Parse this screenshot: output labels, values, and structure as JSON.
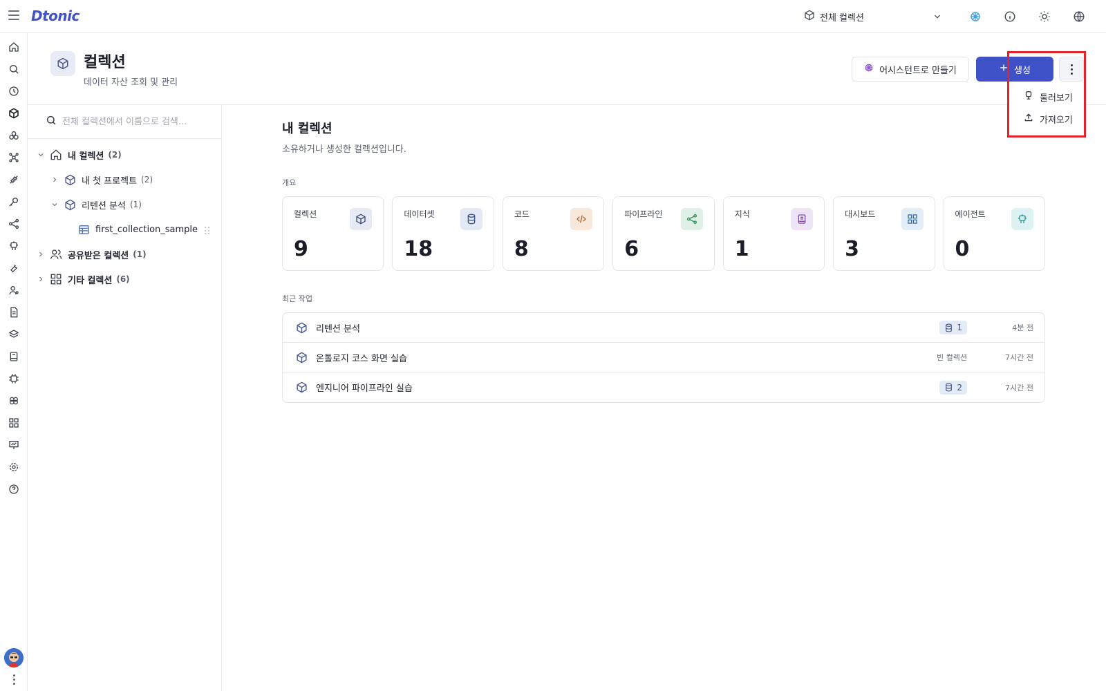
{
  "app": {
    "logo": "Dtonic"
  },
  "topbar": {
    "scope_label": "전체 컬렉션",
    "icons": [
      "cube-icon",
      "chevron-down-icon",
      "assistant-icon",
      "info-icon",
      "theme-sun-icon",
      "globe-icon"
    ]
  },
  "rail": {
    "items": [
      "home-icon",
      "search-icon",
      "history-icon",
      "collection-icon",
      "group-icon",
      "cluster-icon",
      "connector-icon",
      "key-icon",
      "share-icon",
      "agent-icon",
      "tool-icon",
      "user-icon",
      "document-icon",
      "layers-icon",
      "notebook-icon",
      "chip-icon",
      "brain-icon",
      "dashboard-icon",
      "presentation-icon",
      "settings-icon",
      "help-icon"
    ]
  },
  "page": {
    "title": "컬렉션",
    "subtitle": "데이터 자산 조회 및 관리",
    "assistant_button": "어시스턴트로 만들기",
    "create_button": "생성",
    "menu": {
      "items": [
        "둘러보기",
        "가져오기"
      ]
    }
  },
  "tree": {
    "search_placeholder": "전체 컬렉션에서 이름으로 검색...",
    "my_collections": {
      "label": "내 컬렉션",
      "count": "(2)"
    },
    "project1": {
      "label": "내 첫 프로젝트",
      "count": "(2)"
    },
    "project2": {
      "label": "리텐션 분석",
      "count": "(1)"
    },
    "dataset": {
      "label": "first_collection_sample"
    },
    "shared": {
      "label": "공유받은 컬렉션",
      "count": "(1)"
    },
    "other": {
      "label": "기타 컬렉션",
      "count": "(6)"
    }
  },
  "main": {
    "title": "내 컬렉션",
    "subtitle": "소유하거나 생성한 컬렉션입니다.",
    "overview_label": "개요",
    "recent_label": "최근 작업",
    "cards": [
      {
        "label": "컬렉션",
        "value": "9",
        "icon": "cube-icon",
        "bg": "#e6eaf4",
        "fg": "#3d4b7a"
      },
      {
        "label": "데이터셋",
        "value": "18",
        "icon": "database-icon",
        "bg": "#e2e9f5",
        "fg": "#3e5488"
      },
      {
        "label": "코드",
        "value": "8",
        "icon": "code-icon",
        "bg": "#f8e8dc",
        "fg": "#b4622e"
      },
      {
        "label": "파이프라인",
        "value": "6",
        "icon": "pipeline-icon",
        "bg": "#dff1e6",
        "fg": "#2f8a57"
      },
      {
        "label": "지식",
        "value": "1",
        "icon": "book-icon",
        "bg": "#eee4f6",
        "fg": "#7b4ba6"
      },
      {
        "label": "대시보드",
        "value": "3",
        "icon": "dashboard-icon",
        "bg": "#e3eef8",
        "fg": "#3a6fa8"
      },
      {
        "label": "에이전트",
        "value": "0",
        "icon": "agent-icon",
        "bg": "#ddf3f3",
        "fg": "#2a9191"
      }
    ],
    "recent": [
      {
        "name": "리텐션 분석",
        "badge": "1",
        "time": "4분 전"
      },
      {
        "name": "온톨로지 코스 화면 실습",
        "empty_label": "빈 컬렉션",
        "time": "7시간 전"
      },
      {
        "name": "엔지니어 파이프라인 실습",
        "badge": "2",
        "time": "7시간 전"
      }
    ]
  },
  "colors": {
    "primary": "#3f51c6",
    "highlight": "#e0242a"
  }
}
